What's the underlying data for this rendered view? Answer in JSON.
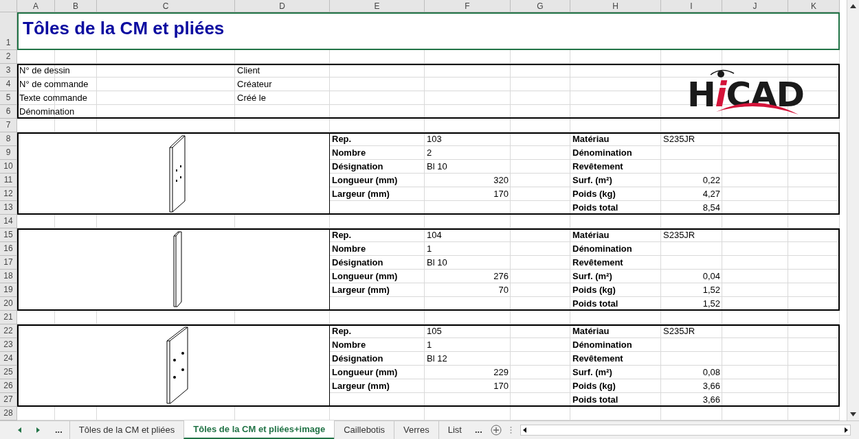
{
  "columns": [
    "A",
    "B",
    "C",
    "D",
    "E",
    "F",
    "G",
    "H",
    "I",
    "J",
    "K"
  ],
  "rows": [
    "1",
    "2",
    "3",
    "4",
    "5",
    "6",
    "7",
    "8",
    "9",
    "10",
    "11",
    "12",
    "13",
    "14",
    "15",
    "16",
    "17",
    "18",
    "19",
    "20",
    "21",
    "22",
    "23",
    "24",
    "25",
    "26",
    "27",
    "28"
  ],
  "title": "Tôles de la CM et pliées",
  "title_selected": true,
  "header": {
    "left": [
      "N° de dessin",
      "N° de commande",
      "Texte commande",
      "Dénomination"
    ],
    "right": [
      "Client",
      "Créateur",
      "Créé le"
    ],
    "logo": "HiCAD"
  },
  "parts": [
    {
      "kind": "plate",
      "left": [
        {
          "label": "Rep.",
          "value": "103",
          "kind": "text"
        },
        {
          "label": "Nombre",
          "value": "2",
          "kind": "text"
        },
        {
          "label": "Désignation",
          "value": "Bl 10",
          "kind": "text"
        },
        {
          "label": "Longueur (mm)",
          "value": "320",
          "kind": "number"
        },
        {
          "label": "Largeur (mm)",
          "value": "170",
          "kind": "number"
        }
      ],
      "right": [
        {
          "label": "Matériau",
          "value": "S235JR",
          "kind": "text"
        },
        {
          "label": "Dénomination"
        },
        {
          "label": "Revêtement"
        },
        {
          "label": "Surf. (m²)",
          "value": "0,22",
          "kind": "number"
        },
        {
          "label": "Poids (kg)",
          "value": "4,27",
          "kind": "number"
        },
        {
          "label": "Poids total",
          "value": "8,54",
          "kind": "number"
        }
      ]
    },
    {
      "kind": "strip",
      "left": [
        {
          "label": "Rep.",
          "value": "104",
          "kind": "text"
        },
        {
          "label": "Nombre",
          "value": "1",
          "kind": "text"
        },
        {
          "label": "Désignation",
          "value": "Bl 10",
          "kind": "text"
        },
        {
          "label": "Longueur (mm)",
          "value": "276",
          "kind": "number"
        },
        {
          "label": "Largeur (mm)",
          "value": "70",
          "kind": "number"
        }
      ],
      "right": [
        {
          "label": "Matériau",
          "value": "S235JR",
          "kind": "text"
        },
        {
          "label": "Dénomination"
        },
        {
          "label": "Revêtement"
        },
        {
          "label": "Surf. (m²)",
          "value": "0,04",
          "kind": "number"
        },
        {
          "label": "Poids (kg)",
          "value": "1,52",
          "kind": "number"
        },
        {
          "label": "Poids total",
          "value": "1,52",
          "kind": "number"
        }
      ]
    },
    {
      "kind": "wide_plate",
      "left": [
        {
          "label": "Rep.",
          "value": "105",
          "kind": "text"
        },
        {
          "label": "Nombre",
          "value": "1",
          "kind": "text"
        },
        {
          "label": "Désignation",
          "value": "Bl 12",
          "kind": "text"
        },
        {
          "label": "Longueur (mm)",
          "value": "229",
          "kind": "number"
        },
        {
          "label": "Largeur (mm)",
          "value": "170",
          "kind": "number"
        }
      ],
      "right": [
        {
          "label": "Matériau",
          "value": "S235JR",
          "kind": "text"
        },
        {
          "label": "Dénomination"
        },
        {
          "label": "Revêtement"
        },
        {
          "label": "Surf. (m²)",
          "value": "0,08",
          "kind": "number"
        },
        {
          "label": "Poids (kg)",
          "value": "3,66",
          "kind": "number"
        },
        {
          "label": "Poids total",
          "value": "3,66",
          "kind": "number"
        }
      ]
    }
  ],
  "sheet_tabs": {
    "more_left": "...",
    "more_right": "...",
    "tabs": [
      {
        "label": "Tôles de la CM et pliées",
        "selected": false
      },
      {
        "label": "Tôles de la CM et pliées+image",
        "selected": true
      },
      {
        "label": "Caillebotis",
        "selected": false
      },
      {
        "label": "Verres",
        "selected": false
      },
      {
        "label": "List",
        "selected": false
      }
    ]
  }
}
